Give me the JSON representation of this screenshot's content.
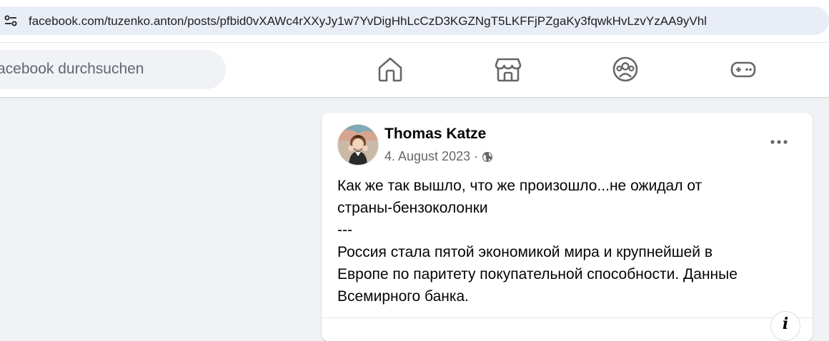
{
  "browser": {
    "url": "facebook.com/tuzenko.anton/posts/pfbid0vXAWc4rXXyJy1w7YvDigHhLcCzD3KGZNgT5LKFFjPZgaKy3fqwkHvLzvYzAA9yVhl",
    "site_info_icon": "tune-icon"
  },
  "navbar": {
    "search_placeholder": "acebook durchsuchen",
    "icons": [
      "home-icon",
      "marketplace-icon",
      "groups-icon",
      "gaming-icon"
    ]
  },
  "post": {
    "author": "Thomas Katze",
    "date": "4. August 2023",
    "separator": "·",
    "privacy_icon": "globe-icon",
    "text": "Как же так вышло, что же произошло...не ожидал от\nстраны-бензоколонки\n---\nРоссия стала пятой экономикой мира и крупнейшей в\nЕвропе по паритету покупательной способности. Данные\nВсемирного банка.",
    "more_icon": "more-horizontal-icon",
    "info_glyph": "i"
  },
  "colors": {
    "page_bg": "#f0f2f5",
    "card_bg": "#ffffff",
    "secondary_text": "#65676b",
    "url_pill": "#e9edf6"
  }
}
